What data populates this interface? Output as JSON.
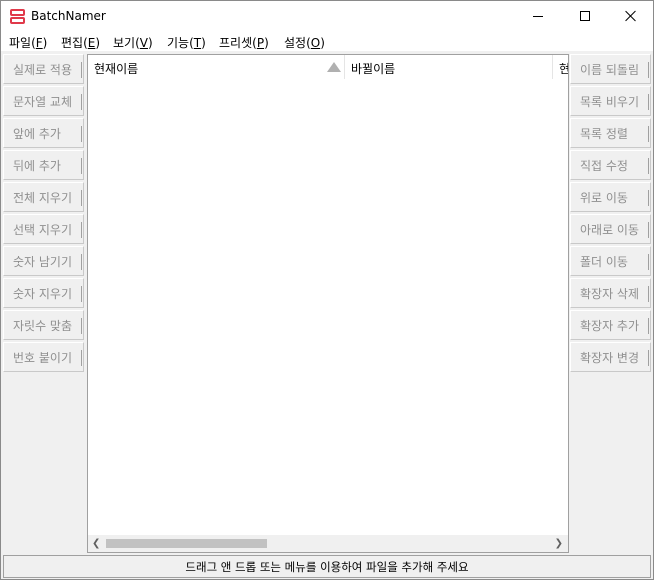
{
  "window": {
    "title": "BatchNamer"
  },
  "menu": [
    {
      "pre": "파일(",
      "key": "F",
      "post": ")"
    },
    {
      "pre": "편집(",
      "key": "E",
      "post": ")"
    },
    {
      "pre": "보기(",
      "key": "V",
      "post": ")"
    },
    {
      "pre": "기능(",
      "key": "T",
      "post": ")"
    },
    {
      "pre": "프리셋(",
      "key": "P",
      "post": ")"
    },
    {
      "pre": "설정(",
      "key": "O",
      "post": ")"
    }
  ],
  "left_buttons": [
    "실제로 적용",
    "문자열 교체",
    "앞에 추가",
    "뒤에 추가",
    "전체 지우기",
    "선택 지우기",
    "숫자 남기기",
    "숫자 지우기",
    "자릿수 맞춤",
    "번호 붙이기"
  ],
  "right_buttons": [
    "이름 되돌림",
    "목록 비우기",
    "목록 정렬",
    "직접 수정",
    "위로 이동",
    "아래로 이동",
    "폴더 이동",
    "확장자 삭제",
    "확장자 추가",
    "확장자 변경"
  ],
  "list": {
    "columns": [
      "현재이름",
      "바뀔이름",
      "현"
    ]
  },
  "status": {
    "message": "드래그 앤 드롭 또는 메뉴를 이용하여 파일을 추가해 주세요"
  },
  "icons": {
    "app": "batchnamer-app-icon",
    "sort": "sort-ascending-icon",
    "scroll_left": "chevron-left-icon",
    "scroll_right": "chevron-right-icon"
  },
  "colors": {
    "app_icon": "#e0394a",
    "disabled_text": "#8f8f8f"
  }
}
